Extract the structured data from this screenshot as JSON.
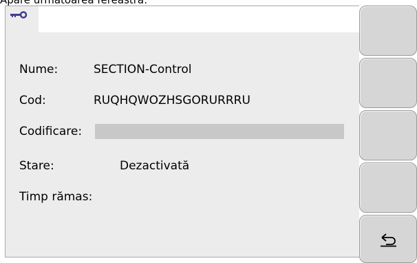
{
  "caption": "Apare următoarea fereastră:",
  "tab": {
    "icon": "key-icon"
  },
  "fields": {
    "name_label": "Nume:",
    "name_value": "SECTION-Control",
    "code_label": "Cod:",
    "code_value": "RUQHQWOZHSGORURRRU",
    "encoding_label": "Codificare:",
    "encoding_value": "",
    "state_label": "Stare:",
    "state_value": "Dezactivată",
    "time_label": "Timp rămas:",
    "time_value": ""
  },
  "softkeys": [
    {
      "icon": ""
    },
    {
      "icon": ""
    },
    {
      "icon": ""
    },
    {
      "icon": ""
    },
    {
      "icon": "back-icon"
    }
  ],
  "colors": {
    "key_icon": "#3d3d8f",
    "panel_bg": "#ececec",
    "softkey_bg": "#d6d6d6",
    "encoding_bar": "#c8c8c8"
  }
}
